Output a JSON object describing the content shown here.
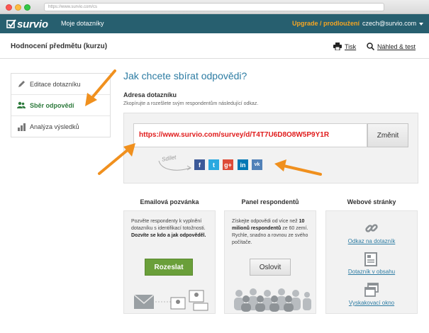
{
  "browser": {
    "url": "https://www.survio.com/cs"
  },
  "topnav": {
    "logo": "survio",
    "surveys": "Moje dotazníky",
    "upgrade": "Upgrade / prodloužení",
    "user": "czech@survio.com"
  },
  "header": {
    "title": "Hodnocení předmětu (kurzu)",
    "print": "Tisk",
    "preview": "Náhled & test"
  },
  "sidebar": {
    "items": [
      {
        "label": "Editace dotazníku",
        "icon": "pencil-icon"
      },
      {
        "label": "Sběr odpovědí",
        "icon": "users-icon",
        "active": true
      },
      {
        "label": "Analýza výsledků",
        "icon": "bar-chart-icon"
      }
    ]
  },
  "main": {
    "title": "Jak chcete sbírat odpovědi?",
    "address_title": "Adresa dotazníku",
    "address_subtitle": "Zkopírujte a rozešlete svým respondentům následující odkaz.",
    "url": "https://www.survio.com/survey/d/T4T7U6D8O8W5P9Y1R",
    "change_button": "Změnit",
    "share_label": "Sdílet",
    "social": [
      "f",
      "t",
      "g+",
      "in",
      "vk"
    ]
  },
  "cards": {
    "email": {
      "title": "Emailová pozvánka",
      "text_plain": "Pozvěte respondenty k vyplnění dotazníku s identifikací totožnosti.",
      "text_bold": "Dozvíte se kdo a jak odpověděl.",
      "button": "Rozeslat"
    },
    "panel": {
      "title": "Panel respondentů",
      "text_prefix": "Získejte odpovědi od více než",
      "text_bold": "10 milionů respondentů",
      "text_suffix": "ze 60 zemí. Rychle, snadno a rovnou ze svého počítače.",
      "button": "Oslovit"
    },
    "web": {
      "title": "Webové stránky",
      "links": [
        "Odkaz na dotazník",
        "Dotazník v obsahu",
        "Vyskakovací okno"
      ]
    }
  },
  "colors": {
    "nav_bg": "#275f6f",
    "accent": "#2d7ca3",
    "upgrade": "#f5a623",
    "url_text": "#e01b1b",
    "send_button": "#6a9f3a",
    "arrow": "#f0901e"
  }
}
